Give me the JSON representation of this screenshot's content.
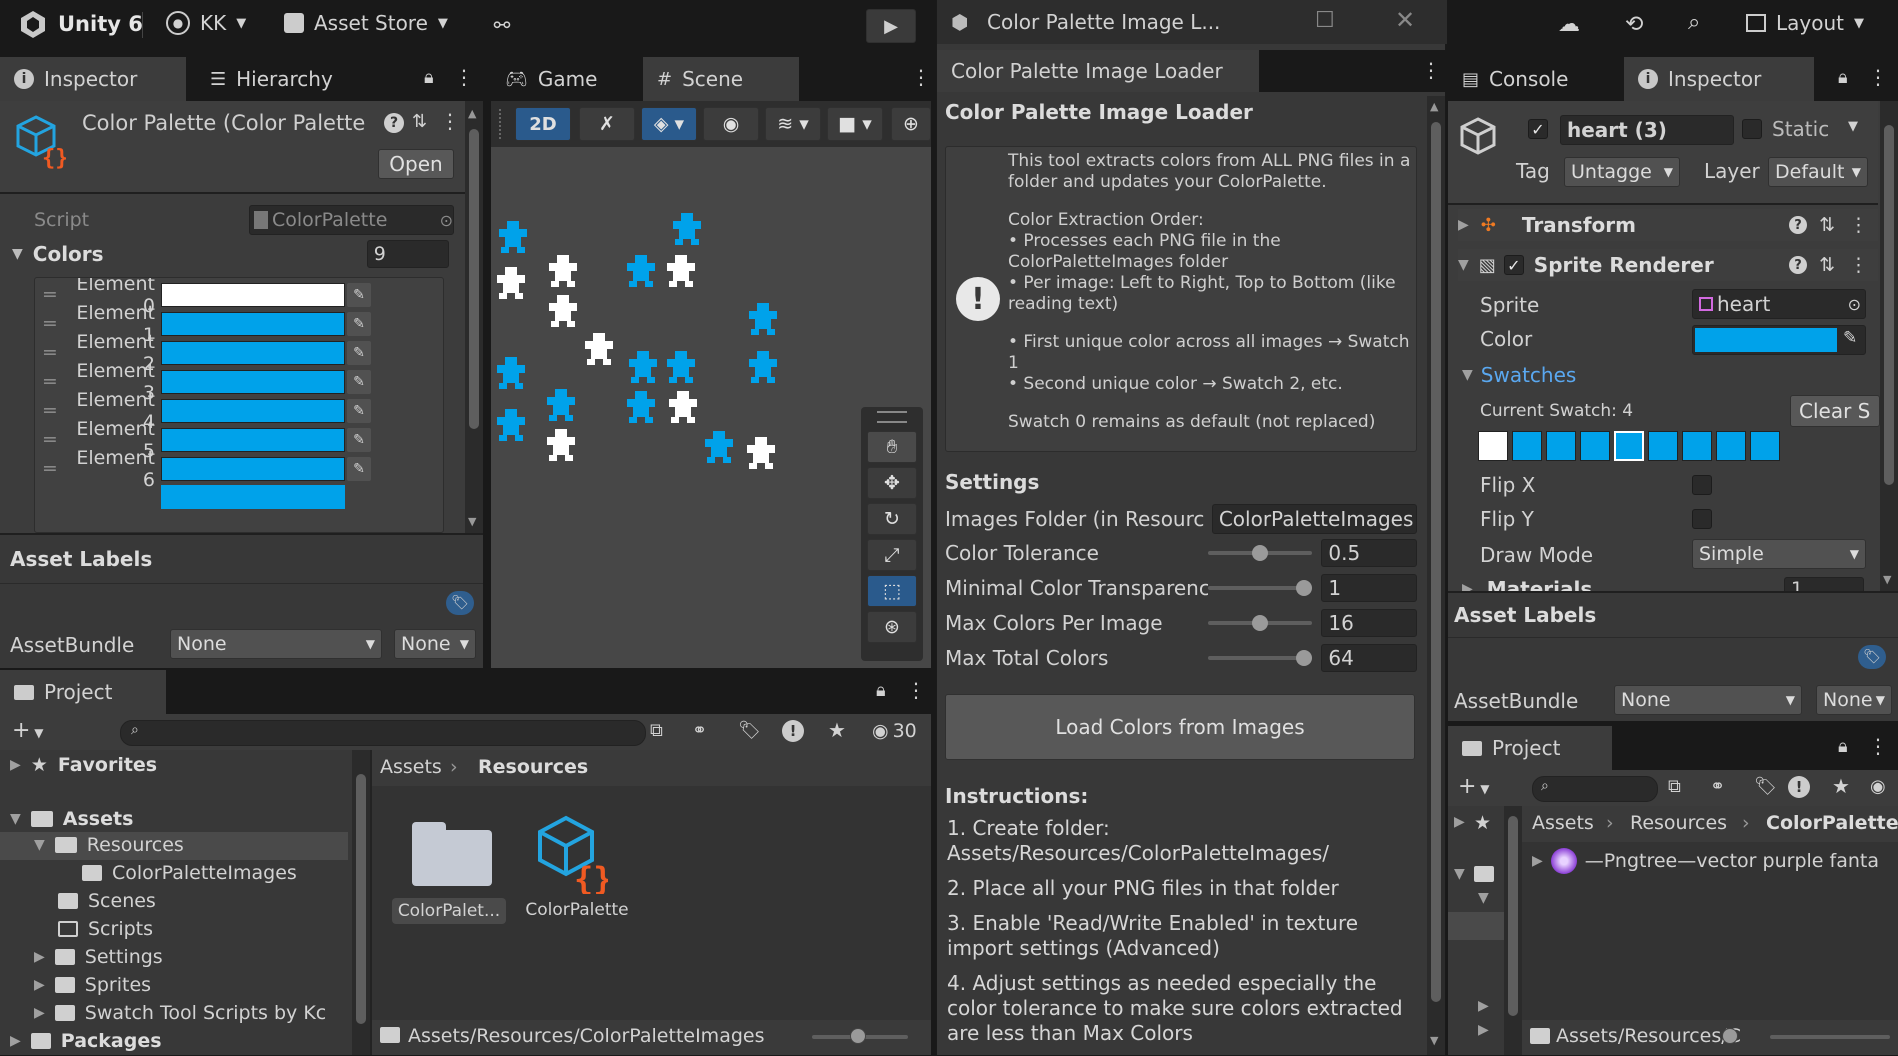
{
  "toolbar": {
    "app": "Unity 6",
    "account": "KK",
    "store": "Asset Store",
    "layout": "Layout"
  },
  "left_tabs": {
    "inspector": "Inspector",
    "hierarchy": "Hierarchy"
  },
  "asset": {
    "title": "Color Palette (Color Palette",
    "open": "Open",
    "script_label": "Script",
    "script_value": "ColorPalette",
    "colors_label": "Colors",
    "colors_count": "9"
  },
  "elements": [
    {
      "label": "Element 0",
      "color": "#ffffff"
    },
    {
      "label": "Element 1",
      "color": "#00a2ea"
    },
    {
      "label": "Element 2",
      "color": "#00a2ea"
    },
    {
      "label": "Element 3",
      "color": "#00a2ea"
    },
    {
      "label": "Element 4",
      "color": "#00a2ea"
    },
    {
      "label": "Element 5",
      "color": "#00a2ea"
    },
    {
      "label": "Element 6",
      "color": "#00a2ea"
    }
  ],
  "asset_labels": {
    "title": "Asset Labels",
    "bundle_label": "AssetBundle",
    "bundle_value": "None",
    "variant_value": "None"
  },
  "scene_tabs": {
    "game": "Game",
    "scene": "Scene",
    "mode": "2D"
  },
  "project": {
    "tab": "Project",
    "count": "30",
    "favorites": "Favorites",
    "assets": "Assets",
    "packages": "Packages",
    "tree": [
      "Resources",
      "ColorPaletteImages",
      "Scenes",
      "Scripts",
      "Settings",
      "Sprites",
      "Swatch Tool Scripts by Kc"
    ],
    "crumb_root": "Assets",
    "crumb_current": "Resources",
    "item1": "ColorPalet...",
    "item2": "ColorPalette",
    "footer": "Assets/Resources/ColorPaletteImages"
  },
  "window": {
    "title": "Color Palette Image L...",
    "tab": "Color Palette Image Loader",
    "header": "Color Palette Image Loader",
    "info": [
      "This tool extracts colors from ALL PNG files in a folder and updates your ColorPalette.",
      "",
      "Color Extraction Order:",
      "• Processes each PNG file in the ColorPaletteImages folder",
      "• Per image: Left to Right, Top to Bottom (like reading text)",
      "",
      "• First unique color across all images → Swatch 1",
      "• Second unique color → Swatch 2, etc.",
      "",
      "Swatch 0 remains as default (not replaced)"
    ],
    "settings_title": "Settings",
    "folder_label": "Images Folder (in Resourc",
    "folder_value": "ColorPaletteImages",
    "sliders": [
      {
        "label": "Color Tolerance",
        "value": "0.5",
        "pos": 0.5
      },
      {
        "label": "Minimal Color Transparenc",
        "value": "1",
        "pos": 1
      },
      {
        "label": "Max Colors Per Image",
        "value": "16",
        "pos": 0.5
      },
      {
        "label": "Max Total Colors",
        "value": "64",
        "pos": 1
      }
    ],
    "load_button": "Load Colors from Images",
    "instructions_title": "Instructions:",
    "steps": [
      "1. Create folder: Assets/Resources/ColorPaletteImages/",
      "2. Place all your PNG files in that folder",
      "3. Enable 'Read/Write Enabled' in texture import settings (Advanced)",
      "4. Adjust settings as needed especially the color tolerance to make sure colors extracted are less than Max Colors"
    ]
  },
  "right": {
    "console": "Console",
    "inspector": "Inspector",
    "object_name": "heart (3)",
    "static": "Static",
    "tag_label": "Tag",
    "tag_value": "Untagge",
    "layer_label": "Layer",
    "layer_value": "Default",
    "transform": "Transform",
    "sprite_renderer": "Sprite Renderer",
    "sprite_label": "Sprite",
    "sprite_value": "heart",
    "color_label": "Color",
    "swatches": "Swatches",
    "current_swatch": "Current Swatch: 4",
    "clear_btn": "Clear S",
    "swatch_colors": [
      "#ffffff",
      "#00a2ea",
      "#00a2ea",
      "#00a2ea",
      "#00a2ea",
      "#00a2ea",
      "#00a2ea",
      "#00a2ea",
      "#00a2ea"
    ],
    "flipx": "Flip X",
    "flipy": "Flip Y",
    "draw_mode_label": "Draw Mode",
    "draw_mode": "Simple",
    "materials": "Materials",
    "materials_count": "1",
    "asset_labels": "Asset Labels",
    "bundle_label": "AssetBundle",
    "bundle_value": "None",
    "variant_value": "None",
    "project": "Project",
    "crumb1": "Assets",
    "crumb2": "Resources",
    "crumb3": "ColorPalette",
    "file": "—Pngtree—vector purple fanta",
    "footer": "Assets/Resources/C"
  }
}
